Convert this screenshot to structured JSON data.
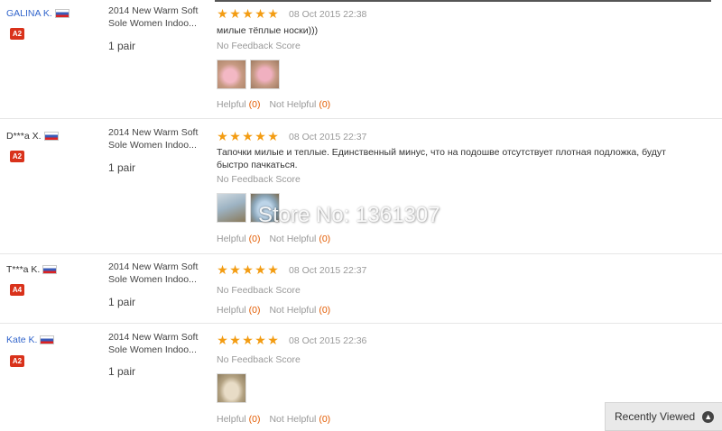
{
  "watermark": "Store No: 1361307",
  "recently_viewed": {
    "label": "Recently Viewed",
    "icon": "chevron-up-icon"
  },
  "colors": {
    "star": "#f39c12",
    "badge": "#d9321b",
    "link": "#3366cc",
    "count": "#e35b00"
  },
  "reviews": [
    {
      "user": "GALINA K.",
      "country_flag": "russia-flag-icon",
      "badge": "A2",
      "product": "2014 New Warm Soft Sole Women Indoo...",
      "quantity": "1 pair",
      "stars": 5,
      "date": "08 Oct 2015 22:38",
      "comment": "милые тёплые носки)))",
      "feedback": "No Feedback Score",
      "helpful_label": "Helpful",
      "helpful_count": "(0)",
      "not_helpful_label": "Not Helpful",
      "not_helpful_count": "(0)"
    },
    {
      "user": "D***a X.",
      "country_flag": "russia-flag-icon",
      "badge": "A2",
      "product": "2014 New Warm Soft Sole Women Indoo...",
      "quantity": "1 pair",
      "stars": 5,
      "date": "08 Oct 2015 22:37",
      "comment": "Тапочки милые и теплые. Единственный минус, что на подошве отсутствует плотная подложка, будут быстро пачкаться.",
      "feedback": "No Feedback Score",
      "helpful_label": "Helpful",
      "helpful_count": "(0)",
      "not_helpful_label": "Not Helpful",
      "not_helpful_count": "(0)"
    },
    {
      "user": "T***a K.",
      "country_flag": "russia-flag-icon",
      "badge": "A4",
      "product": "2014 New Warm Soft Sole Women Indoo...",
      "quantity": "1 pair",
      "stars": 5,
      "date": "08 Oct 2015 22:37",
      "comment": "",
      "feedback": "No Feedback Score",
      "helpful_label": "Helpful",
      "helpful_count": "(0)",
      "not_helpful_label": "Not Helpful",
      "not_helpful_count": "(0)"
    },
    {
      "user": "Kate K.",
      "country_flag": "russia-flag-icon",
      "badge": "A2",
      "product": "2014 New Warm Soft Sole Women Indoo...",
      "quantity": "1 pair",
      "stars": 5,
      "date": "08 Oct 2015 22:36",
      "comment": "",
      "feedback": "No Feedback Score",
      "helpful_label": "Helpful",
      "helpful_count": "(0)",
      "not_helpful_label": "Not Helpful",
      "not_helpful_count": "(0)"
    }
  ]
}
